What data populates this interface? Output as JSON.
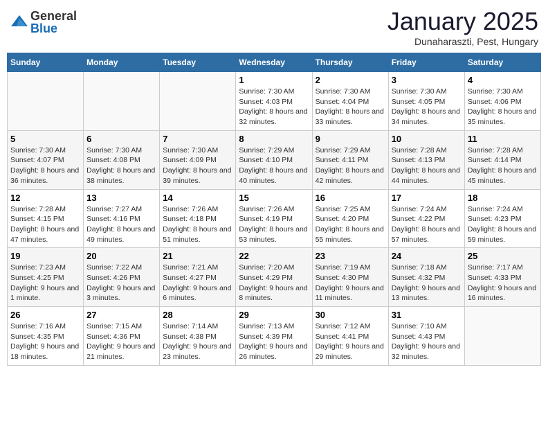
{
  "header": {
    "logo_general": "General",
    "logo_blue": "Blue",
    "month_title": "January 2025",
    "location": "Dunaharaszti, Pest, Hungary"
  },
  "days_of_week": [
    "Sunday",
    "Monday",
    "Tuesday",
    "Wednesday",
    "Thursday",
    "Friday",
    "Saturday"
  ],
  "weeks": [
    [
      {
        "day": "",
        "info": ""
      },
      {
        "day": "",
        "info": ""
      },
      {
        "day": "",
        "info": ""
      },
      {
        "day": "1",
        "info": "Sunrise: 7:30 AM\nSunset: 4:03 PM\nDaylight: 8 hours and 32 minutes."
      },
      {
        "day": "2",
        "info": "Sunrise: 7:30 AM\nSunset: 4:04 PM\nDaylight: 8 hours and 33 minutes."
      },
      {
        "day": "3",
        "info": "Sunrise: 7:30 AM\nSunset: 4:05 PM\nDaylight: 8 hours and 34 minutes."
      },
      {
        "day": "4",
        "info": "Sunrise: 7:30 AM\nSunset: 4:06 PM\nDaylight: 8 hours and 35 minutes."
      }
    ],
    [
      {
        "day": "5",
        "info": "Sunrise: 7:30 AM\nSunset: 4:07 PM\nDaylight: 8 hours and 36 minutes."
      },
      {
        "day": "6",
        "info": "Sunrise: 7:30 AM\nSunset: 4:08 PM\nDaylight: 8 hours and 38 minutes."
      },
      {
        "day": "7",
        "info": "Sunrise: 7:30 AM\nSunset: 4:09 PM\nDaylight: 8 hours and 39 minutes."
      },
      {
        "day": "8",
        "info": "Sunrise: 7:29 AM\nSunset: 4:10 PM\nDaylight: 8 hours and 40 minutes."
      },
      {
        "day": "9",
        "info": "Sunrise: 7:29 AM\nSunset: 4:11 PM\nDaylight: 8 hours and 42 minutes."
      },
      {
        "day": "10",
        "info": "Sunrise: 7:28 AM\nSunset: 4:13 PM\nDaylight: 8 hours and 44 minutes."
      },
      {
        "day": "11",
        "info": "Sunrise: 7:28 AM\nSunset: 4:14 PM\nDaylight: 8 hours and 45 minutes."
      }
    ],
    [
      {
        "day": "12",
        "info": "Sunrise: 7:28 AM\nSunset: 4:15 PM\nDaylight: 8 hours and 47 minutes."
      },
      {
        "day": "13",
        "info": "Sunrise: 7:27 AM\nSunset: 4:16 PM\nDaylight: 8 hours and 49 minutes."
      },
      {
        "day": "14",
        "info": "Sunrise: 7:26 AM\nSunset: 4:18 PM\nDaylight: 8 hours and 51 minutes."
      },
      {
        "day": "15",
        "info": "Sunrise: 7:26 AM\nSunset: 4:19 PM\nDaylight: 8 hours and 53 minutes."
      },
      {
        "day": "16",
        "info": "Sunrise: 7:25 AM\nSunset: 4:20 PM\nDaylight: 8 hours and 55 minutes."
      },
      {
        "day": "17",
        "info": "Sunrise: 7:24 AM\nSunset: 4:22 PM\nDaylight: 8 hours and 57 minutes."
      },
      {
        "day": "18",
        "info": "Sunrise: 7:24 AM\nSunset: 4:23 PM\nDaylight: 8 hours and 59 minutes."
      }
    ],
    [
      {
        "day": "19",
        "info": "Sunrise: 7:23 AM\nSunset: 4:25 PM\nDaylight: 9 hours and 1 minute."
      },
      {
        "day": "20",
        "info": "Sunrise: 7:22 AM\nSunset: 4:26 PM\nDaylight: 9 hours and 3 minutes."
      },
      {
        "day": "21",
        "info": "Sunrise: 7:21 AM\nSunset: 4:27 PM\nDaylight: 9 hours and 6 minutes."
      },
      {
        "day": "22",
        "info": "Sunrise: 7:20 AM\nSunset: 4:29 PM\nDaylight: 9 hours and 8 minutes."
      },
      {
        "day": "23",
        "info": "Sunrise: 7:19 AM\nSunset: 4:30 PM\nDaylight: 9 hours and 11 minutes."
      },
      {
        "day": "24",
        "info": "Sunrise: 7:18 AM\nSunset: 4:32 PM\nDaylight: 9 hours and 13 minutes."
      },
      {
        "day": "25",
        "info": "Sunrise: 7:17 AM\nSunset: 4:33 PM\nDaylight: 9 hours and 16 minutes."
      }
    ],
    [
      {
        "day": "26",
        "info": "Sunrise: 7:16 AM\nSunset: 4:35 PM\nDaylight: 9 hours and 18 minutes."
      },
      {
        "day": "27",
        "info": "Sunrise: 7:15 AM\nSunset: 4:36 PM\nDaylight: 9 hours and 21 minutes."
      },
      {
        "day": "28",
        "info": "Sunrise: 7:14 AM\nSunset: 4:38 PM\nDaylight: 9 hours and 23 minutes."
      },
      {
        "day": "29",
        "info": "Sunrise: 7:13 AM\nSunset: 4:39 PM\nDaylight: 9 hours and 26 minutes."
      },
      {
        "day": "30",
        "info": "Sunrise: 7:12 AM\nSunset: 4:41 PM\nDaylight: 9 hours and 29 minutes."
      },
      {
        "day": "31",
        "info": "Sunrise: 7:10 AM\nSunset: 4:43 PM\nDaylight: 9 hours and 32 minutes."
      },
      {
        "day": "",
        "info": ""
      }
    ]
  ]
}
